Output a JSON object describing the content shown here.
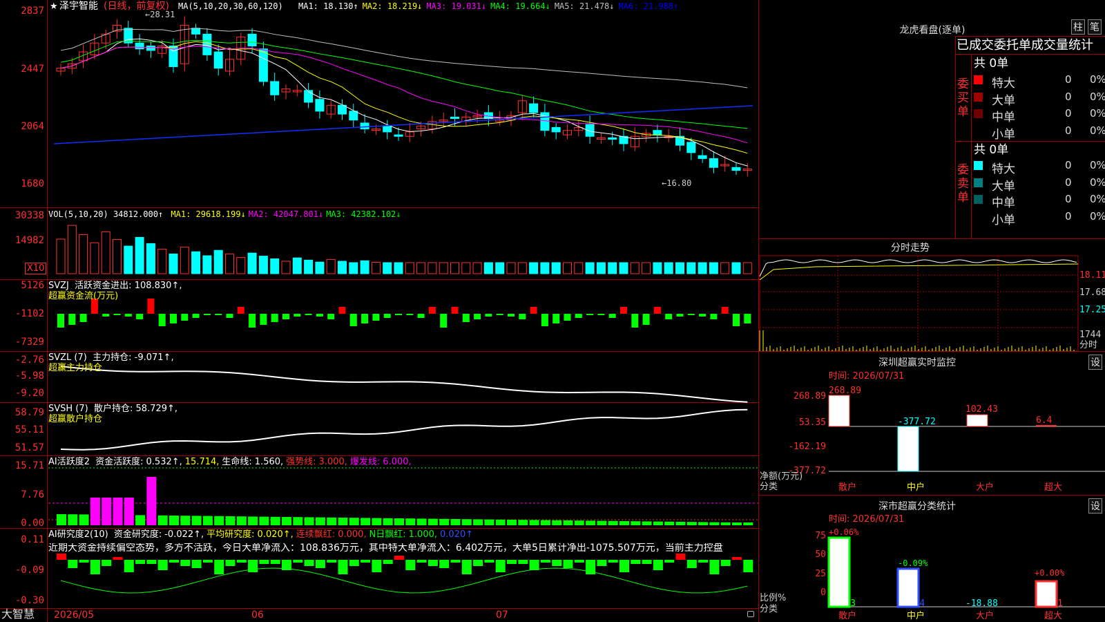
{
  "header": {
    "stock_name": "泽宇智能",
    "mode": "(日线，前复权)",
    "high_mark": "28.31",
    "low_mark": "16.80",
    "ma_label": "MA(5,10,20,30,60,120)",
    "mas": [
      {
        "label": "MA1:",
        "value": "18.130",
        "arrow": "↑",
        "color": "#ffffff"
      },
      {
        "label": "MA2:",
        "value": "18.219",
        "arrow": "↓",
        "color": "#ffff00"
      },
      {
        "label": "MA3:",
        "value": "19.031",
        "arrow": "↓",
        "color": "#ff00ff"
      },
      {
        "label": "MA4:",
        "value": "19.664",
        "arrow": "↓",
        "color": "#00ff00"
      },
      {
        "label": "MA5:",
        "value": "21.478",
        "arrow": "↓",
        "color": "#c0c0c0"
      },
      {
        "label": "MA6:",
        "value": "21.988",
        "arrow": "↑",
        "color": "#0000ff"
      }
    ]
  },
  "price_axis": [
    "2837",
    "2447",
    "2064",
    "1680"
  ],
  "vol_panel": {
    "title": "VOL(5,10,20)",
    "value": "34812.000↑",
    "mas": [
      {
        "label": "MA1:",
        "value": "29618.199↓",
        "color": "#ffff00"
      },
      {
        "label": "MA2:",
        "value": "42047.801↓",
        "color": "#ff00ff"
      },
      {
        "label": "MA3:",
        "value": "42382.102↓",
        "color": "#00ff00"
      }
    ],
    "axis": [
      "30338",
      "14982"
    ],
    "unit": "X10"
  },
  "svzj_panel": {
    "title": "SVZJ",
    "label": "活跃资金进出:",
    "value": "108.830↑,",
    "subtitle": "超赢资金流(万元)",
    "axis": [
      "5126",
      "-1102",
      "-7329"
    ]
  },
  "svzl_panel": {
    "title": "SVZL (7)",
    "label": "主力持仓:",
    "value": "-9.071↑,",
    "subtitle": "超赢主力持仓",
    "axis": [
      "-2.76",
      "-5.98",
      "-9.20"
    ]
  },
  "svsh_panel": {
    "title": "SVSH (7)",
    "label": "散户持仓:",
    "value": "58.729↑,",
    "subtitle": "超赢散户持仓",
    "axis": [
      "58.79",
      "55.11",
      "51.57"
    ]
  },
  "ai2_panel": {
    "title": "AI活跃度2",
    "items": [
      {
        "text": "资金活跃度:",
        "color": "#ffffff"
      },
      {
        "text": "0.532↑,",
        "color": "#ffffff"
      },
      {
        "text": "15.714,",
        "color": "#ffff00"
      },
      {
        "text": "生命线:",
        "color": "#ffffff"
      },
      {
        "text": "1.560,",
        "color": "#ffffff"
      },
      {
        "text": "强势线:",
        "color": "#ff3030"
      },
      {
        "text": "3.000,",
        "color": "#ff3030"
      },
      {
        "text": "爆发线:",
        "color": "#ff00ff"
      },
      {
        "text": "6.000,",
        "color": "#ff00ff"
      }
    ],
    "axis": [
      "15.71",
      "7.76",
      "0.00"
    ]
  },
  "ai_research_panel": {
    "title": "AI研究度2(10)",
    "items": [
      {
        "text": "资金研究度:",
        "color": "#ffffff"
      },
      {
        "text": "-0.022↑,",
        "color": "#ffffff"
      },
      {
        "text": "平均研究度:",
        "color": "#ffff00"
      },
      {
        "text": "0.020↑,",
        "color": "#ffff00"
      },
      {
        "text": "连续飘红:",
        "color": "#ff3030"
      },
      {
        "text": "0.000,",
        "color": "#ff3030"
      },
      {
        "text": "N日飘红:",
        "color": "#00ff00"
      },
      {
        "text": "1.000,",
        "color": "#00ff00"
      },
      {
        "text": "0.020↑",
        "color": "#3050ff"
      }
    ],
    "commentary": "近期大资金持续偏空态势，多方不活跃，今日大单净流入：108.836万元，其中特大单净流入：6.402万元，大单5日累计净出-1075.507万元，当前主力控盘",
    "axis": [
      "0.11",
      "-0.09",
      "-0.30"
    ]
  },
  "time_axis": [
    "2026/05",
    "06",
    "07"
  ],
  "bottom_left": "大智慧",
  "right": {
    "dragon_title": "龙虎看盘(逐单)",
    "btn_zhu": "柱",
    "btn_bi": "笔",
    "table_header": "已成交委托单成交量统计",
    "buy_side": "委买单",
    "sell_side": "委卖单",
    "buy_total": "共 0单",
    "sell_total": "共 0单",
    "buy_rows": [
      {
        "label": "特大",
        "count": "0",
        "pct": "0%",
        "color": "#ff0000"
      },
      {
        "label": "大单",
        "count": "0",
        "pct": "0%",
        "color": "#a00000"
      },
      {
        "label": "中单",
        "count": "0",
        "pct": "0%",
        "color": "#700000"
      },
      {
        "label": "小单",
        "count": "0",
        "pct": "0%",
        "color": ""
      }
    ],
    "sell_rows": [
      {
        "label": "特大",
        "count": "0",
        "pct": "0%",
        "color": "#00ffff"
      },
      {
        "label": "大单",
        "count": "0",
        "pct": "0%",
        "color": "#008080"
      },
      {
        "label": "中单",
        "count": "0",
        "pct": "0%",
        "color": "#006060"
      },
      {
        "label": "小单",
        "count": "0",
        "pct": "0%",
        "color": ""
      }
    ],
    "intraday_title": "分时走势",
    "intraday_axis": [
      "18.11",
      "17.68",
      "17.25",
      "1744"
    ],
    "intraday_unit": "分时",
    "sz_title": "深圳超赢实时监控",
    "sz_btn": "设",
    "sz_time": "时间: 2026/07/31",
    "sz_axis": [
      "268.89",
      "53.35",
      "-162.19",
      "-377.72"
    ],
    "sz_ylabel": "净额(万元)",
    "sz_xlabel": "分类",
    "sz_categories": [
      "散户",
      "中户",
      "大户",
      "超大"
    ],
    "sz_values": [
      "268.89",
      "-377.72",
      "102.43",
      "6.4"
    ],
    "cls_title": "深市超赢分类统计",
    "cls_btn": "设",
    "cls_time": "时间: 2026/07/31",
    "cls_axis": [
      "75",
      "50",
      "25",
      "0"
    ],
    "cls_ylabel": "比例%",
    "cls_xlabel": "分类",
    "cls_categories": [
      "散户",
      "中户",
      "大户",
      "超大"
    ],
    "cls_top": [
      "+0.06%",
      "-0.09%",
      "",
      "+0.00%"
    ],
    "cls_values": [
      "70.23",
      "31.84",
      "-18.88",
      "16.81"
    ]
  }
}
